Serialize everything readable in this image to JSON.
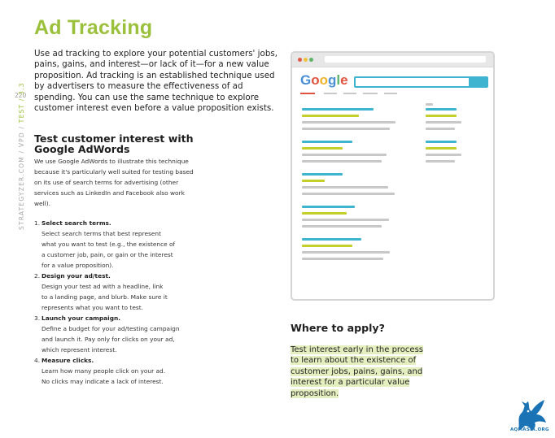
{
  "title": "Ad Tracking",
  "intro": "Use ad tracking to explore your potential customers' jobs, pains, gains, and interest—or lack of it—for a new value proposition. Ad tracking is an established technique used by advertisers to measure the effectiveness of ad spending. You can use the same technique to explore customer interest even before a value proposition exists.",
  "sidebar": {
    "page_number": "220",
    "path_prefix": "STRATEGYZER.COM / VPD / ",
    "path_highlight": "TEST / 3.3"
  },
  "section": {
    "heading": "Test customer interest with Google AdWords",
    "body": "We use Google AdWords to illustrate this technique because it's particularly well suited for testing based on its use of search terms for advertising (other services such as LinkedIn and Facebook also work well).",
    "steps": [
      {
        "num": "1.",
        "title": "Select search terms.",
        "text": "Select search terms that best represent\nwhat you want to test (e.g., the existence of\na customer job, pain, or gain or the interest\nfor a value proposition)."
      },
      {
        "num": "2.",
        "title": "Design your ad/test.",
        "text": "Design your test ad with a headline, link\nto a landing page, and blurb. Make sure it\nrepresents what you want to test."
      },
      {
        "num": "3.",
        "title": "Launch your campaign.",
        "text": "Define a budget for your ad/testing campaign\nand launch it. Pay only for clicks on your ad,\nwhich represent interest."
      },
      {
        "num": "4.",
        "title": "Measure clicks.",
        "text": "Learn how many people click on your ad.\nNo clicks may indicate a lack of interest."
      }
    ]
  },
  "illustration": {
    "logo_letters": [
      "G",
      "o",
      "o",
      "g",
      "l",
      "e"
    ],
    "logo_colors": [
      "#4a8fd6",
      "#e0533e",
      "#f0b429",
      "#4a8fd6",
      "#5db36a",
      "#e0533e"
    ],
    "accent_blue": "#3fb4d0",
    "accent_yellow": "#c5cf2a"
  },
  "apply": {
    "heading": "Where to apply?",
    "text": "Test interest early in the process to learn about the existence of customer jobs, pains, gains, and interest for a particular value proposition."
  },
  "brand": {
    "text": "AQMASIA.ORG"
  }
}
